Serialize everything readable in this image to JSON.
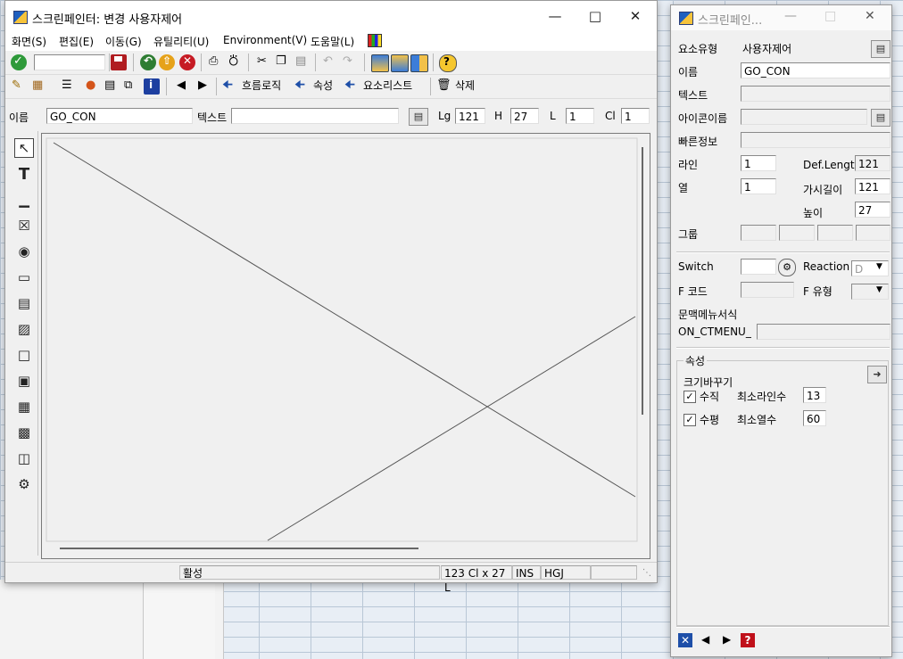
{
  "main_window": {
    "title": "스크린페인터: 변경 사용자제어",
    "menu": [
      "화면(S)",
      "편집(E)",
      "이동(G)",
      "유틸리티(U)",
      "Environment(V)",
      "도움말(L)"
    ],
    "toolbar2": {
      "flow_logic": "흐름로직",
      "attributes": "속성",
      "element_list": "요소리스트",
      "delete": "삭제"
    },
    "fields": {
      "name_label": "이름",
      "name_value": "GO_CON",
      "text_label": "텍스트",
      "text_value": "",
      "lg_label": "Lg",
      "lg_value": "121",
      "h_label": "H",
      "h_value": "27",
      "l_label": "L",
      "l_value": "1",
      "cl_label": "Cl",
      "cl_value": "1"
    },
    "status": {
      "mode": "활성",
      "position": "123 Cl x 27 L",
      "ins": "INS",
      "hgj": "HGJ"
    }
  },
  "attr_window": {
    "title": "스크린페인...",
    "element_type_label": "요소유형",
    "element_type_value": "사용자제어",
    "name_label": "이름",
    "name_value": "GO_CON",
    "text_label": "텍스트",
    "icon_name_label": "아이콘이름",
    "quick_info_label": "빠른정보",
    "line_label": "라인",
    "line_value": "1",
    "col_label": "열",
    "col_value": "1",
    "def_length_label": "Def.Lengtl",
    "def_length_value": "121",
    "visible_length_label": "가시길이",
    "visible_length_value": "121",
    "height_label": "높이",
    "height_value": "27",
    "group_label": "그룹",
    "switch_label": "Switch",
    "reaction_label": "Reaction",
    "reaction_value": "D",
    "fcode_label": "F 코드",
    "ftype_label": "F 유형",
    "context_menu_label": "문맥메뉴서식",
    "context_menu_prefix": "ON_CTMENU_",
    "attributes_group_label": "속성",
    "resize_label": "크기바꾸기",
    "vertical_label": "수직",
    "vertical_checked": true,
    "min_lines_label": "최소라인수",
    "min_lines_value": "13",
    "horizontal_label": "수평",
    "horizontal_checked": true,
    "min_cols_label": "최소열수",
    "min_cols_value": "60"
  },
  "colors": {
    "window_bg": "#f0f0f0",
    "background_grid": "#b9c7d6",
    "accent_blue": "#1e4fa8",
    "help_red": "#c0101a"
  }
}
